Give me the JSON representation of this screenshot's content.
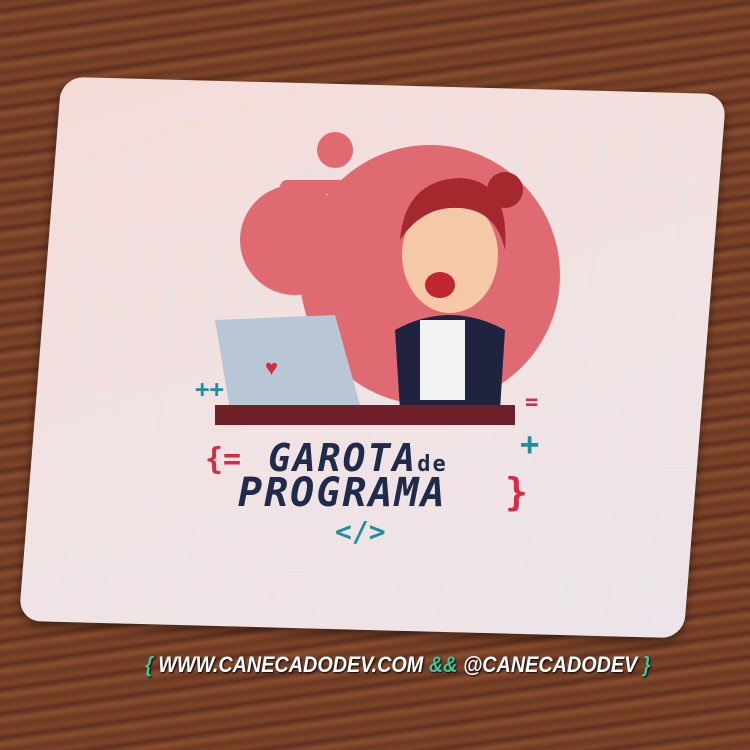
{
  "mousepad": {
    "title_line1": "GAROTA",
    "title_de": "de",
    "title_line2": "PROGRAMA",
    "brace_open": "{=",
    "brace_close": "}",
    "code_tag": "</>",
    "plus_plus": "++",
    "plus": "+",
    "equals": "="
  },
  "footer": {
    "open": "{",
    "website": "WWW.CANECADODEV.COM",
    "and": "&&",
    "handle": "@CANECADODEV",
    "close": "}"
  },
  "colors": {
    "accent_red": "#d62b43",
    "accent_teal": "#1f8fa0",
    "footer_green": "#3cc79a",
    "text_navy": "#202a4a"
  }
}
